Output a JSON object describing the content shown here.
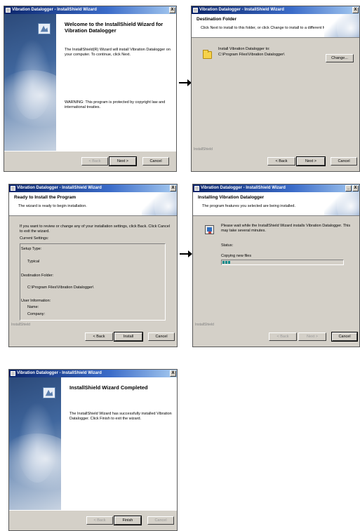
{
  "window_title": "Vibration Datalogger - InstallShield Wizard",
  "close_glyph": "X",
  "minimize_glyph": "_",
  "brand_text": "InstallShield",
  "buttons": {
    "back": "< Back",
    "next": "Next >",
    "cancel": "Cancel",
    "change": "Change...",
    "install": "Install",
    "finish": "Finish"
  },
  "welcome": {
    "title": "Welcome to the InstallShield Wizard for Vibration Datalogger",
    "body": "The InstallShield(R) Wizard will install Vibration Datalogger on your computer. To continue, click Next.",
    "warning": "WARNING: This program is protected by copyright law and international treaties."
  },
  "destination": {
    "title": "Destination Folder",
    "subtitle": "Click Next to install to this folder, or click Change to install to a different folder.",
    "install_to_label": "Install Vibration Datalogger to:",
    "path": "C:\\Program Files\\Vibration Datalogger\\"
  },
  "ready": {
    "title": "Ready to Install the Program",
    "subtitle": "The wizard is ready to begin installation.",
    "body": "If you want to review or change any of your installation settings, click Back. Click Cancel to exit the wizard.",
    "current_settings": "Current Settings:",
    "setup_type_label": "Setup Type:",
    "setup_type_value": "Typical",
    "dest_folder_label": "Destination Folder:",
    "dest_folder_value": "C:\\Program Files\\Vibration Datalogger\\",
    "user_info_label": "User Information:",
    "name_label": "Name:",
    "company_label": "Company:"
  },
  "installing": {
    "title": "Installing Vibration Datalogger",
    "subtitle": "The program features you selected are being installed.",
    "body": "Please wait while the InstallShield Wizard installs Vibration Datalogger. This may take several minutes.",
    "status_label": "Status:",
    "status_value": "Copying new files",
    "progress_fraction": 0.08
  },
  "completed": {
    "title": "InstallShield Wizard Completed",
    "body": "The InstallShield Wizard has successfully installed Vibration Datalogger. Click Finish to exit the wizard."
  },
  "colors": {
    "title_bar": "#0a246a",
    "dialog_face": "#d4d0c8",
    "progress_fill": "#0a8a8a"
  }
}
